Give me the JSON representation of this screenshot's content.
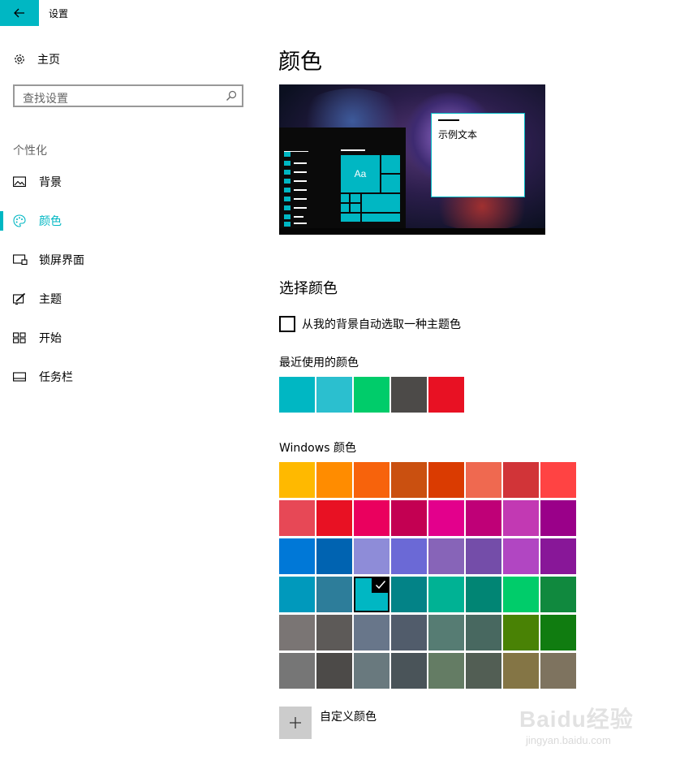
{
  "window": {
    "title": "设置"
  },
  "sidebar": {
    "home_label": "主页",
    "search_placeholder": "查找设置",
    "section_label": "个性化",
    "items": [
      {
        "label": "背景",
        "icon": "picture-icon",
        "active": false
      },
      {
        "label": "颜色",
        "icon": "palette-icon",
        "active": true
      },
      {
        "label": "锁屏界面",
        "icon": "lock-screen-icon",
        "active": false
      },
      {
        "label": "主题",
        "icon": "theme-icon",
        "active": false
      },
      {
        "label": "开始",
        "icon": "start-icon",
        "active": false
      },
      {
        "label": "任务栏",
        "icon": "taskbar-icon",
        "active": false
      }
    ]
  },
  "main": {
    "title": "颜色",
    "preview": {
      "sample_text": "示例文本",
      "tile_text": "Aa"
    },
    "choose_heading": "选择颜色",
    "auto_checkbox_label": "从我的背景自动选取一种主题色",
    "auto_checked": false,
    "recent_label": "最近使用的颜色",
    "recent_colors": [
      "#00b7c3",
      "#2bbfcf",
      "#00cc6a",
      "#4c4a48",
      "#e81123"
    ],
    "windows_label": "Windows 颜色",
    "windows_colors": [
      [
        "#ffb900",
        "#ff8c00",
        "#f7630c",
        "#ca5010",
        "#da3b01",
        "#ef6950",
        "#d13438",
        "#ff4343"
      ],
      [
        "#e74856",
        "#e81123",
        "#ea005e",
        "#c30052",
        "#e3008c",
        "#bf0077",
        "#c239b3",
        "#9a0089"
      ],
      [
        "#0078d7",
        "#0063b1",
        "#8e8cd8",
        "#6b69d6",
        "#8764b8",
        "#744da9",
        "#b146c2",
        "#881798"
      ],
      [
        "#0099bc",
        "#2d7d9a",
        "#00b7c3",
        "#038387",
        "#00b294",
        "#018574",
        "#00cc6a",
        "#10893e"
      ],
      [
        "#7a7574",
        "#5d5a58",
        "#68768a",
        "#515c6b",
        "#567c73",
        "#486860",
        "#498205",
        "#107c10"
      ],
      [
        "#767676",
        "#4c4a48",
        "#69797e",
        "#4a5459",
        "#647c64",
        "#525e54",
        "#847545",
        "#7e735f"
      ]
    ],
    "selected_color": "#00b7c3",
    "custom_color_label": "自定义颜色"
  },
  "watermark": {
    "text": "Baidu经验",
    "url_text": "jingyan.baidu.com"
  }
}
